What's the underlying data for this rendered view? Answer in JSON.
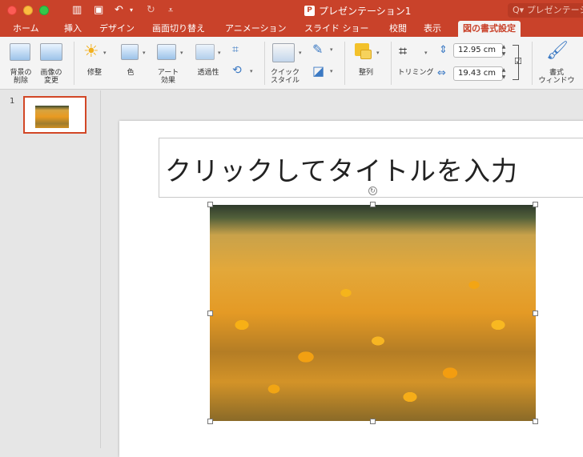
{
  "window": {
    "title": "プレゼンテーション1",
    "search_placeholder": "プレゼンテーション"
  },
  "tabs": [
    {
      "label": "ホーム"
    },
    {
      "label": "挿入"
    },
    {
      "label": "デザイン"
    },
    {
      "label": "画面切り替え"
    },
    {
      "label": "アニメーション"
    },
    {
      "label": "スライド ショー"
    },
    {
      "label": "校閲"
    },
    {
      "label": "表示"
    },
    {
      "label": "図の書式設定"
    }
  ],
  "ribbon": {
    "remove_background": "背景の\n削除",
    "change_picture": "画像の\n変更",
    "corrections": "修整",
    "color": "色",
    "artistic_effects": "アート\n効果",
    "transparency": "透過性",
    "quick_styles": "クイック\nスタイル",
    "arrange": "整列",
    "crop": "トリミング",
    "height_value": "12.95 cm",
    "width_value": "19.43 cm",
    "format_pane": "書式\nウィンドウ"
  },
  "slides": {
    "current_number": "1"
  },
  "slide": {
    "title_placeholder": "クリックしてタイトルを入力"
  }
}
